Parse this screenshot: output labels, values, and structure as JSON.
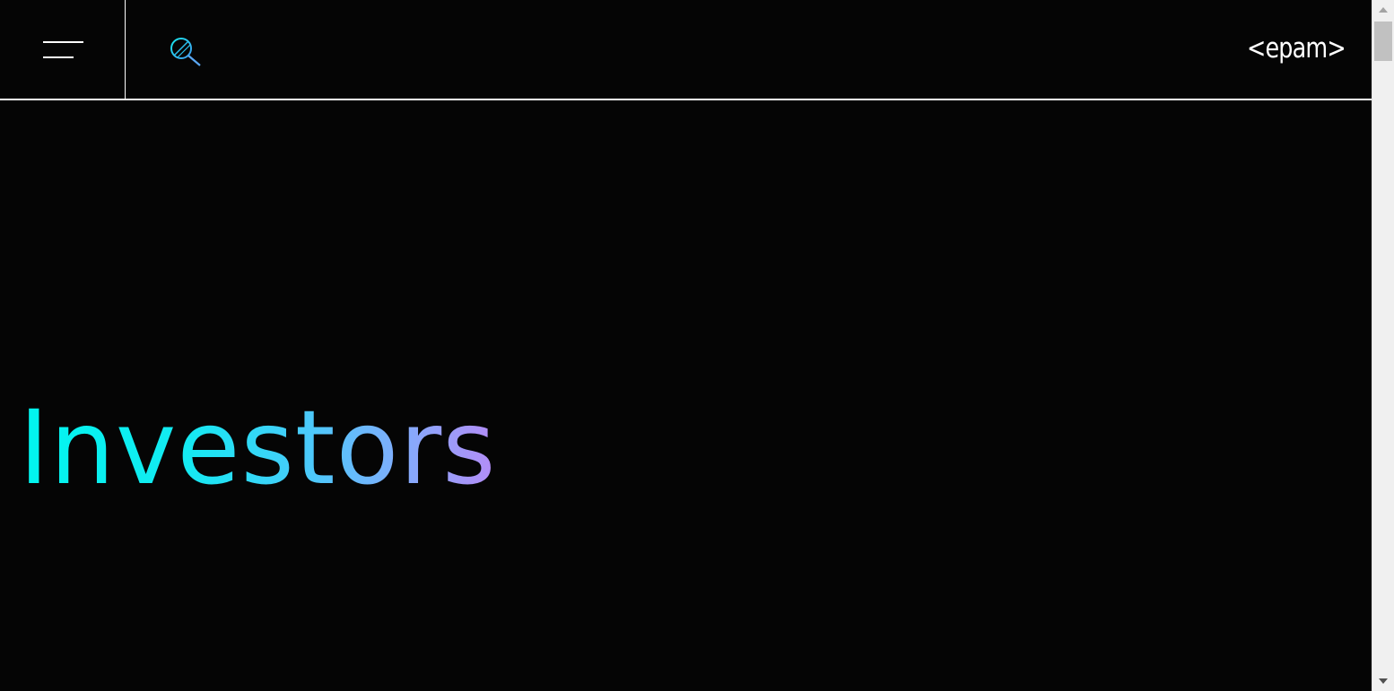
{
  "header": {
    "menu_icon": "hamburger-menu-icon",
    "search_icon": "search-icon",
    "logo_text": "<epam>"
  },
  "hero": {
    "title": "Investors"
  },
  "colors": {
    "background": "#050505",
    "header_border": "#ffffff",
    "gradient_start": "#00f6ef",
    "gradient_end": "#b58cf7",
    "search_icon_stroke": "#22c7dd"
  }
}
